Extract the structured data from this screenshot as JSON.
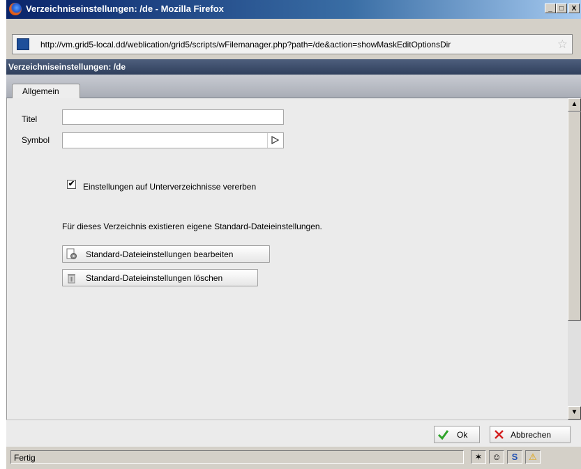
{
  "window": {
    "title": "Verzeichniseinstellungen: /de - Mozilla Firefox",
    "minimize": "_",
    "maximize": "□",
    "close": "X"
  },
  "address": {
    "url": "http://vm.grid5-local.dd/weblication/grid5/scripts/wFilemanager.php?path=/de&action=showMaskEditOptionsDir"
  },
  "dialog": {
    "title": "Verzeichniseinstellungen: /de"
  },
  "tabs": [
    {
      "label": "Allgemein",
      "active": true
    }
  ],
  "form": {
    "title_label": "Titel",
    "title_value": "",
    "symbol_label": "Symbol",
    "symbol_value": "",
    "inherit_checked": true,
    "inherit_label": "Einstellungen auf Unterverzeichnisse vererben",
    "info_text": "Für dieses Verzeichnis existieren eigene Standard-Dateieinstellungen.",
    "edit_button": "Standard-Dateieinstellungen bearbeiten",
    "delete_button": "Standard-Dateieinstellungen löschen"
  },
  "footer": {
    "ok_label": "Ok",
    "cancel_label": "Abbrechen"
  },
  "statusbar": {
    "text": "Fertig"
  },
  "colors": {
    "dialog_title_bg": "#2f3f5c",
    "content_bg": "#ebebeb",
    "chrome": "#d4d0c8",
    "ok_icon": "#2fa32a",
    "cancel_icon": "#d42323"
  },
  "icons": [
    "firefox-icon",
    "site-identity-icon",
    "bookmark-star-icon",
    "play-triangle-icon",
    "gear-file-icon",
    "trash-icon",
    "check-icon",
    "x-icon",
    "spider-icon",
    "face-icon",
    "s-icon",
    "warning-icon"
  ]
}
